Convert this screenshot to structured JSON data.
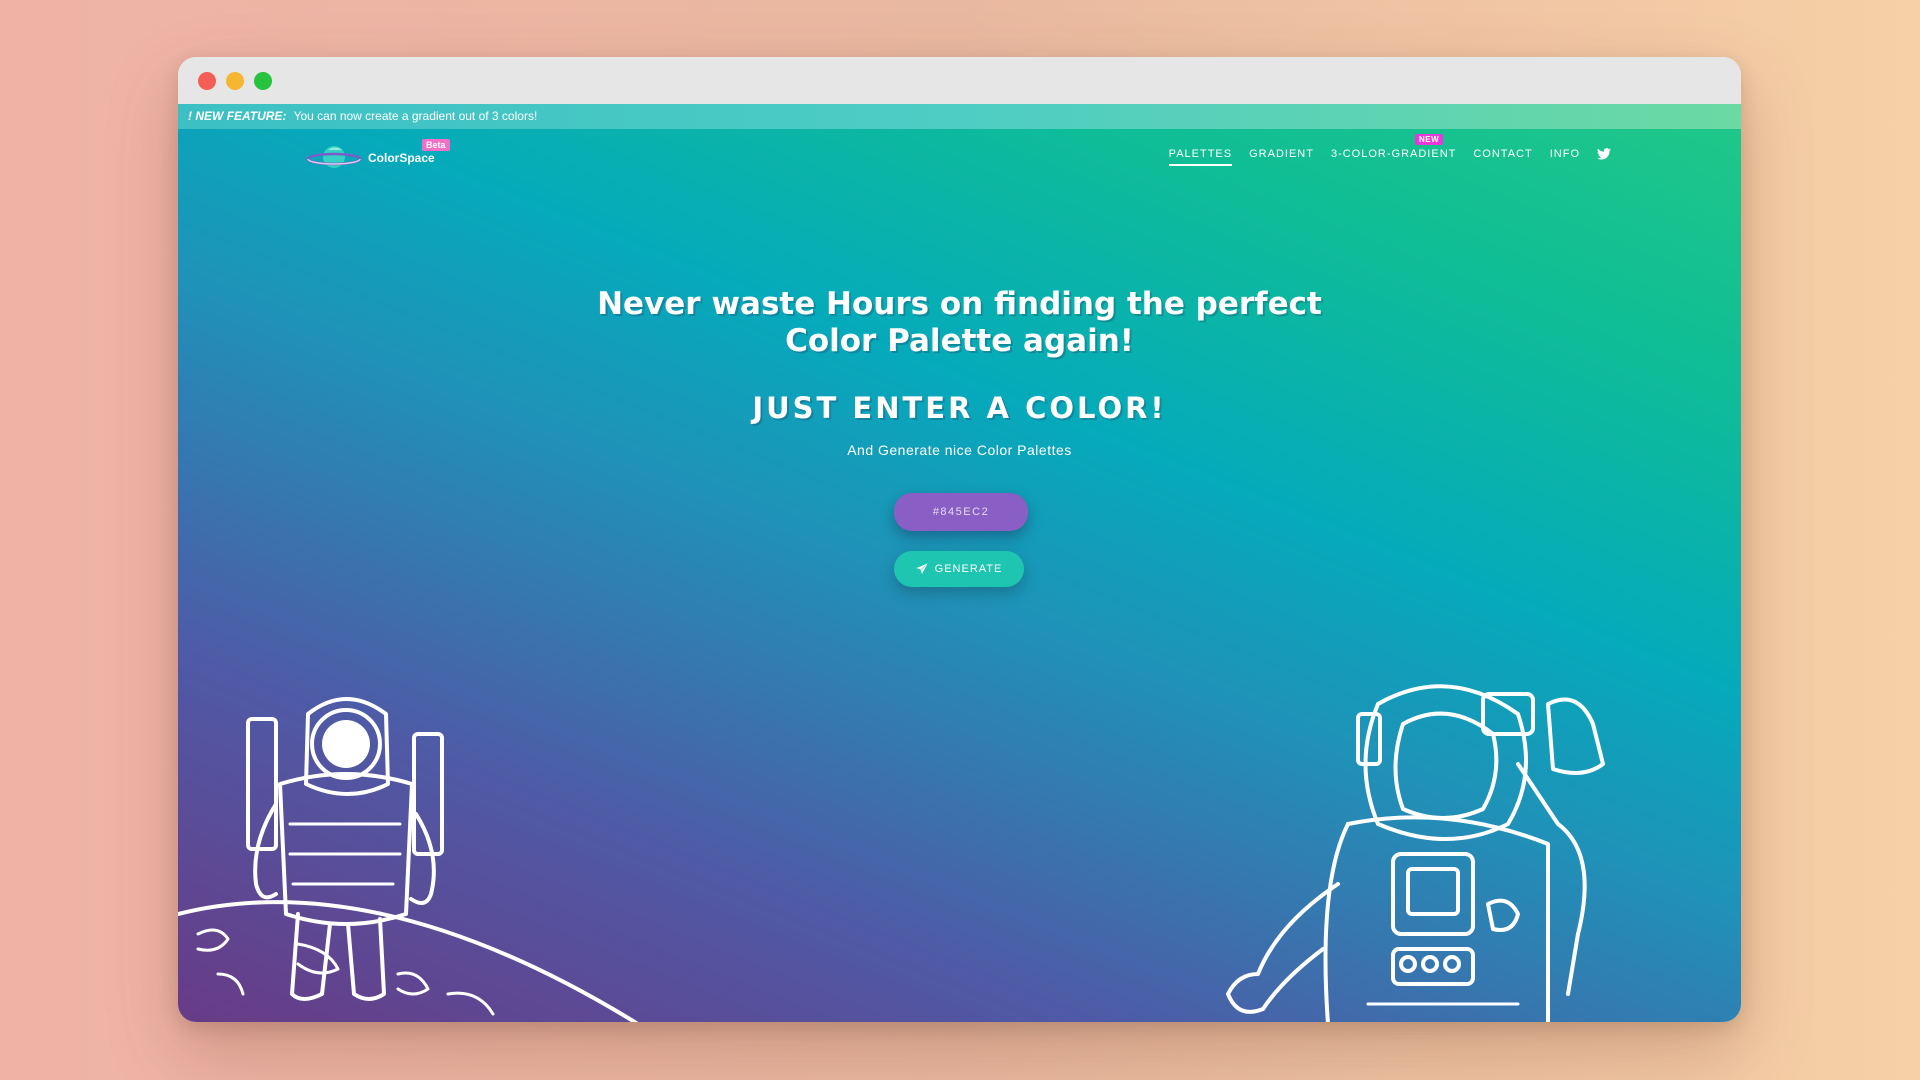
{
  "banner": {
    "label": "! NEW FEATURE:",
    "text": "You can now create a gradient out of 3 colors!"
  },
  "logo": {
    "name": "ColorSpace",
    "badge": "Beta"
  },
  "nav": {
    "items": [
      {
        "label": "PALETTES",
        "active": true
      },
      {
        "label": "GRADIENT"
      },
      {
        "label": "3-COLOR-GRADIENT",
        "badge": "NEW"
      },
      {
        "label": "CONTACT"
      },
      {
        "label": "INFO"
      }
    ],
    "social_icon": "twitter-icon"
  },
  "hero": {
    "headline_line1": "Never waste Hours on finding the perfect",
    "headline_line2": "Color Palette again!",
    "subhead": "JUST ENTER A COLOR!",
    "tagline": "And Generate nice Color Palettes"
  },
  "color_input": {
    "value": "#845EC2"
  },
  "generate_button": {
    "label": "GENERATE",
    "icon": "rocket-icon"
  },
  "colors": {
    "input_bg": "#8a5fc5",
    "button_bg": "#1ec6b1",
    "beta_badge": "#f06fc9",
    "new_badge": "#e838d9"
  }
}
